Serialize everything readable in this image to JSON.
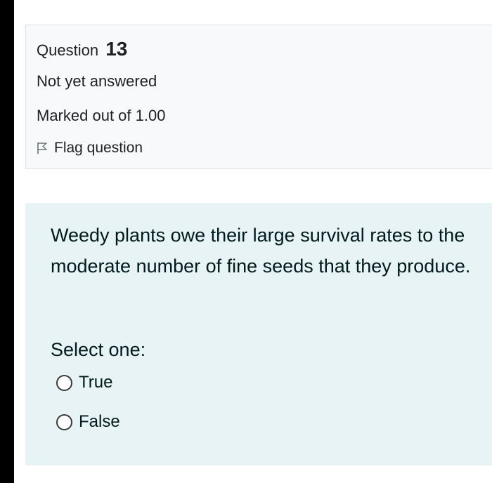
{
  "question_info": {
    "label": "Question",
    "number": "13",
    "state": "Not yet answered",
    "grade": "Marked out of 1.00",
    "flag_label": "Flag question"
  },
  "question": {
    "text": "Weedy plants owe their large survival rates to the moderate number of fine seeds that they produce.",
    "prompt": "Select one:",
    "options": [
      {
        "label": "True",
        "selected": false
      },
      {
        "label": "False",
        "selected": false
      }
    ]
  },
  "icons": {
    "flag": "flag-outline-icon",
    "radio": "radio-unchecked-icon"
  },
  "colors": {
    "info_background": "#f8f9fa",
    "content_background": "#e7f3f5",
    "side_bar": "#000000"
  }
}
